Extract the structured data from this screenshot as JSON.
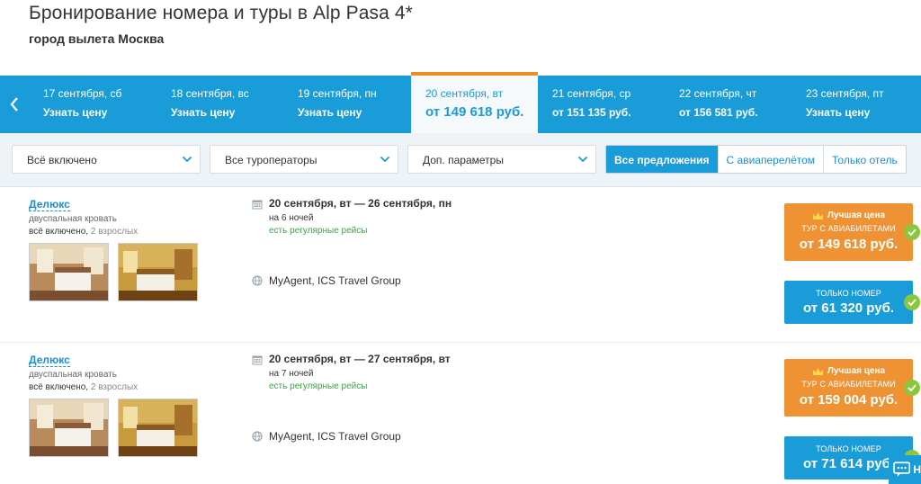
{
  "header": {
    "title": "Бронирование номера и туры в Alp Pasa 4*",
    "subtitle": "город вылета Москва"
  },
  "dates": [
    {
      "date": "17 сентября, сб",
      "price": "Узнать цену",
      "active": false
    },
    {
      "date": "18 сентября, вс",
      "price": "Узнать цену",
      "active": false
    },
    {
      "date": "19 сентября, пн",
      "price": "Узнать цену",
      "active": false
    },
    {
      "date": "20 сентября, вт",
      "price": "от 149 618 руб.",
      "active": true
    },
    {
      "date": "21 сентября, ср",
      "price": "от 151 135 руб.",
      "active": false
    },
    {
      "date": "22 сентября, чт",
      "price": "от 156 581 руб.",
      "active": false
    },
    {
      "date": "23 сентября, пт",
      "price": "Узнать цену",
      "active": false
    }
  ],
  "filters": {
    "meal": "Всё включено",
    "operators": "Все туроператоры",
    "params": "Доп. параметры",
    "segments": [
      "Все предложения",
      "С авиаперелётом",
      "Только отель"
    ],
    "segment_active": 0
  },
  "offers": [
    {
      "room": "Делюкс",
      "bed": "двуспальная кровать",
      "meal": "всё включено,",
      "guests": "2 взрослых",
      "dates": "20 сентября, вт — 26 сентября, пн",
      "nights": "на 6 ночей",
      "flights": "есть регулярные рейсы",
      "agent": "MyAgent, ICS Travel Group",
      "best_label": "Лучшая цена",
      "tour_label": "ТУР С АВИАБИЛЕТАМИ",
      "tour_price": "от 149 618 руб.",
      "room_label": "ТОЛЬКО НОМЕР",
      "room_price": "от 61 320 руб."
    },
    {
      "room": "Делюкс",
      "bed": "двуспальная кровать",
      "meal": "всё включено,",
      "guests": "2 взрослых",
      "dates": "20 сентября, вт — 27 сентября, вт",
      "nights": "на 7 ночей",
      "flights": "есть регулярные рейсы",
      "agent": "MyAgent, ICS Travel Group",
      "best_label": "Лучшая цена",
      "tour_label": "ТУР С АВИАБИЛЕТАМИ",
      "tour_price": "от 159 004 руб.",
      "room_label": "ТОЛЬКО НОМЕР",
      "room_price": "от 71 614 руб."
    }
  ],
  "chat": {
    "label": "Н"
  },
  "icons": {
    "prev": "chevron-left-icon",
    "dropdown": "chevron-down-icon",
    "calendar": "calendar-icon",
    "globe": "globe-icon",
    "crown": "crown-icon",
    "check": "check-icon",
    "chat": "chat-icon"
  },
  "colors": {
    "accent": "#1a9cd8",
    "orange": "#ef9233",
    "green": "#8cc63f",
    "active_tab_border": "#f08c22"
  }
}
